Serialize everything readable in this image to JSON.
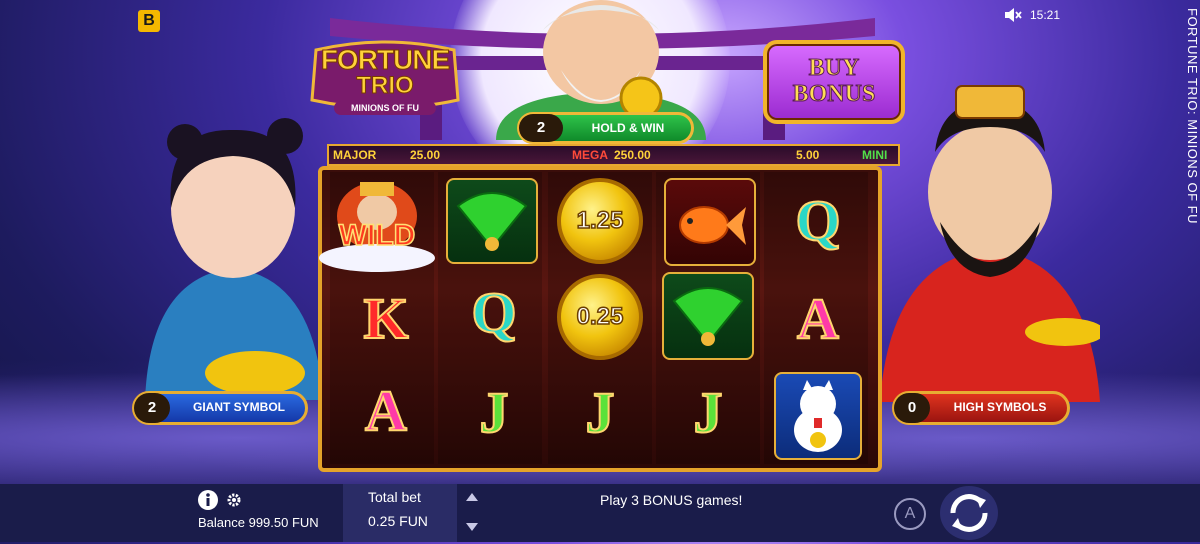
{
  "status_bar": {
    "brand_letter": "B",
    "time": "15:21",
    "mute_icon": "speaker-muted-icon"
  },
  "game_title_vertical": "FORTUNE TRIO: MINIONS OF FU",
  "logo": {
    "line1": "FORTUNE",
    "line2": "TRIO",
    "line3": "MINIONS OF FU"
  },
  "buy_bonus": {
    "line1": "BUY",
    "line2": "BONUS"
  },
  "hold_and_win": {
    "count": "2",
    "label": "HOLD & WIN"
  },
  "jackpots": [
    {
      "name": "MAJOR",
      "value": "25.00"
    },
    {
      "name": "MEGA",
      "value": "250.00"
    },
    {
      "name": "MINI",
      "value": "5.00"
    }
  ],
  "reels": [
    [
      "WILD",
      "K",
      "A"
    ],
    [
      "fan",
      "Q",
      "J"
    ],
    [
      "1.25",
      "0.25",
      "J"
    ],
    [
      "koi-fish",
      "fan",
      "J"
    ],
    [
      "Q",
      "A",
      "lucky-cat"
    ]
  ],
  "features": {
    "giant_symbol": {
      "count": "2",
      "label": "GIANT SYMBOL"
    },
    "high_symbols": {
      "count": "0",
      "label": "HIGH SYMBOLS"
    }
  },
  "bottom_bar": {
    "info_icon": "info-icon",
    "settings_icon": "gear-icon",
    "balance_text": "Balance 999.50 FUN",
    "total_bet_label": "Total bet",
    "total_bet_value": "0.25 FUN",
    "message": "Play 3 BONUS games!",
    "autoplay_label": "A",
    "spin_icon": "spin-icon"
  },
  "colors": {
    "gold": "#e7ad33",
    "hold_win_green": "#1fa83a",
    "mega_red": "#ff4a3a",
    "bottom_bar": "#1a1c4a"
  }
}
